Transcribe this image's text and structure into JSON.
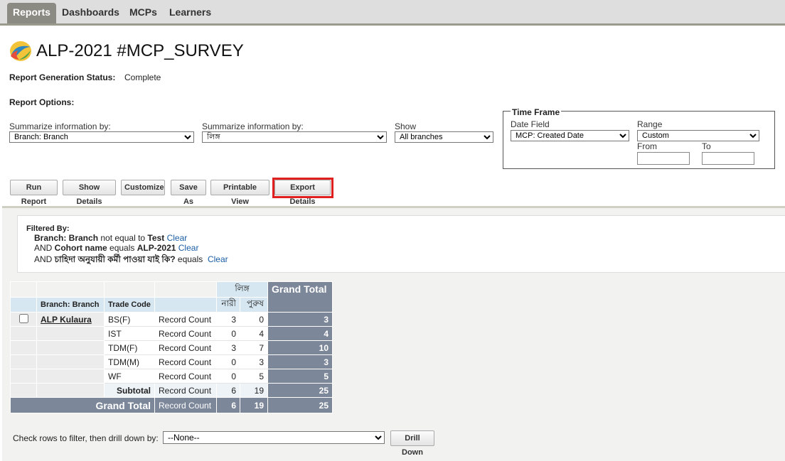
{
  "nav": {
    "tabs": [
      "Reports",
      "Dashboards",
      "MCPs",
      "Learners"
    ]
  },
  "page": {
    "title": "ALP-2021 #MCP_SURVEY"
  },
  "status": {
    "label": "Report Generation Status:",
    "value": "Complete"
  },
  "options": {
    "label": "Report Options:",
    "summarize1_label": "Summarize information by:",
    "summarize1_value": "Branch: Branch",
    "summarize2_label": "Summarize information by:",
    "summarize2_value": "লিঙ্গ",
    "show_label": "Show",
    "show_value": "All branches"
  },
  "timeframe": {
    "legend": "Time Frame",
    "date_field_label": "Date Field",
    "date_field_value": "MCP: Created Date",
    "range_label": "Range",
    "range_value": "Custom",
    "from_label": "From",
    "to_label": "To"
  },
  "buttons": {
    "run": "Run Report",
    "details": "Show Details",
    "customize": "Customize",
    "saveas": "Save As",
    "printable": "Printable View",
    "export": "Export Details"
  },
  "filter": {
    "title": "Filtered By:",
    "line1_field": "Branch: Branch",
    "line1_op": " not equal to ",
    "line1_val": "Test",
    "line2_prefix": "AND ",
    "line2_field": "Cohort name",
    "line2_op": " equals ",
    "line2_val": "ALP-2021",
    "line3_prefix": "AND ",
    "line3_field": "চাহিদা অনুযায়ী কর্মী পাওয়া যাই কি?",
    "line3_op": " equals",
    "clear": "Clear"
  },
  "table": {
    "group_header": "লিঙ্গ",
    "grand_total_header": "Grand Total",
    "col_branch": "Branch: Branch",
    "col_trade": "Trade Code",
    "col_nari": "নারী",
    "col_purush": "পুরুষ",
    "branch": "ALP Kulaura",
    "measure": "Record Count",
    "rows": [
      {
        "trade": "BS(F)",
        "nari": "3",
        "purush": "0",
        "total": "3"
      },
      {
        "trade": "IST",
        "nari": "0",
        "purush": "4",
        "total": "4"
      },
      {
        "trade": "TDM(F)",
        "nari": "3",
        "purush": "7",
        "total": "10"
      },
      {
        "trade": "TDM(M)",
        "nari": "0",
        "purush": "3",
        "total": "3"
      },
      {
        "trade": "WF",
        "nari": "0",
        "purush": "5",
        "total": "5"
      }
    ],
    "subtotal_label": "Subtotal",
    "subtotal": {
      "nari": "6",
      "purush": "19",
      "total": "25"
    },
    "grand_label": "Grand Total",
    "grand": {
      "nari": "6",
      "purush": "19",
      "total": "25"
    }
  },
  "drill": {
    "label": "Check rows to filter, then drill down by:",
    "value": "--None--",
    "button": "Drill Down"
  }
}
